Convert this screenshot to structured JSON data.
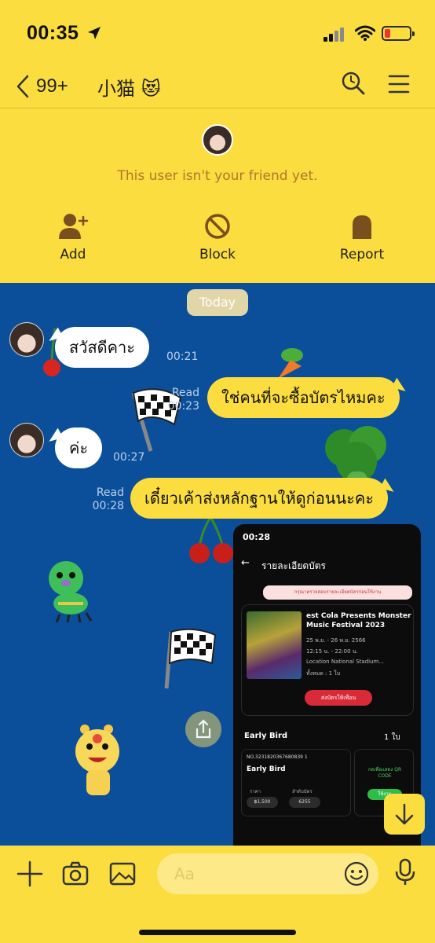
{
  "status_bar": {
    "time": "00:35"
  },
  "header": {
    "back_count": "99+",
    "title": "小猫 😻"
  },
  "friend_banner": {
    "note": "This user isn't your friend yet.",
    "actions": [
      {
        "label": "Add",
        "icon": "add-friend-icon"
      },
      {
        "label": "Block",
        "icon": "block-icon"
      },
      {
        "label": "Report",
        "icon": "report-icon"
      }
    ]
  },
  "chat": {
    "date_label": "Today",
    "messages": [
      {
        "sender": "other",
        "text": "สวัสดีคาะ",
        "time": "00:21"
      },
      {
        "sender": "me",
        "text": "ใช่คนที่จะซื้อบัตรไหมคะ",
        "read": "Read",
        "time": "00:23"
      },
      {
        "sender": "other",
        "text": "ค่ะ",
        "time": "00:27"
      },
      {
        "sender": "me",
        "text": "เดี๋ยวเค้าส่งหลักฐานให้ดูก่อนนะคะ",
        "read": "Read",
        "time": "00:28"
      }
    ],
    "image_message": {
      "status_time": "00:28",
      "page_title": "รายละเอียดบัตร",
      "alert": "กรุณาตรวจสอบรายละเอียดบัตรก่อนใช้งาน",
      "event_name": "est Cola Presents Monster Music Festival 2023",
      "date": "25 พ.ย. - 26 พ.ย. 2566",
      "time": "12:15 น. - 22:00 น.",
      "location": "Location National Stadium...",
      "quantity": "ทั้งหมด : 1 ใบ",
      "share_label": "ส่งบัตรให้เพื่อน",
      "section": "Early Bird",
      "section_qty": "1 ใบ",
      "ticket_no": "NO.3231820367680839 1",
      "ticket_name": "Early Bird",
      "price_label": "ราคา",
      "price": "฿1,500",
      "seat_label": "ลำดับบัตร",
      "seat": "6255",
      "qr_text": "กดเพื่อแสดง QR CODE",
      "qr_button": "ใช้งาน"
    }
  },
  "input_bar": {
    "placeholder": "Aa"
  },
  "colors": {
    "header_yellow": "#fbdd3f",
    "chat_blue": "#0b4f9a",
    "note_brown": "#b0772b"
  }
}
